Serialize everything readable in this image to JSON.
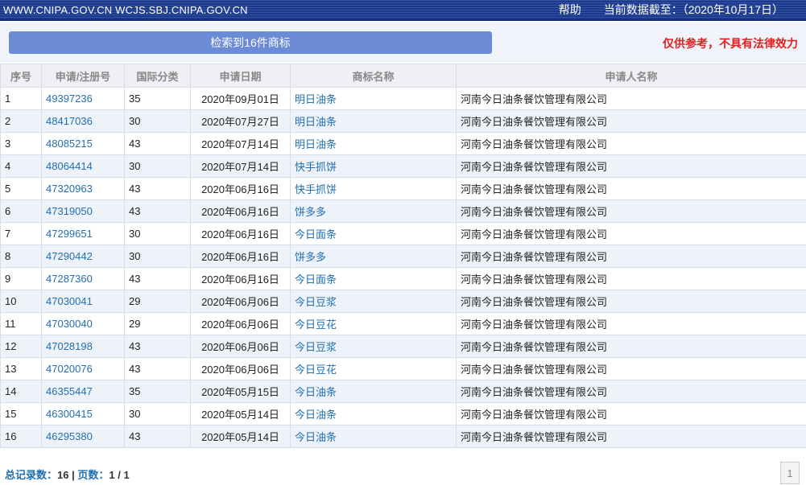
{
  "topbar": {
    "site": "WWW.CNIPA.GOV.CN WCJS.SBJ.CNIPA.GOV.CN",
    "help": "帮助",
    "data_date": "当前数据截至：（2020年10月17日）"
  },
  "search": {
    "count_label": "检索到16件商标",
    "notice": "仅供参考，不具有法律效力"
  },
  "table": {
    "headers": [
      "序号",
      "申请/注册号",
      "国际分类",
      "申请日期",
      "商标名称",
      "申请人名称"
    ],
    "rows": [
      [
        "1",
        "49397236",
        "35",
        "2020年09月01日",
        "明日油条",
        "河南今日油条餐饮管理有限公司"
      ],
      [
        "2",
        "48417036",
        "30",
        "2020年07月27日",
        "明日油条",
        "河南今日油条餐饮管理有限公司"
      ],
      [
        "3",
        "48085215",
        "43",
        "2020年07月14日",
        "明日油条",
        "河南今日油条餐饮管理有限公司"
      ],
      [
        "4",
        "48064414",
        "30",
        "2020年07月14日",
        "快手抓饼",
        "河南今日油条餐饮管理有限公司"
      ],
      [
        "5",
        "47320963",
        "43",
        "2020年06月16日",
        "快手抓饼",
        "河南今日油条餐饮管理有限公司"
      ],
      [
        "6",
        "47319050",
        "43",
        "2020年06月16日",
        "饼多多",
        "河南今日油条餐饮管理有限公司"
      ],
      [
        "7",
        "47299651",
        "30",
        "2020年06月16日",
        "今日面条",
        "河南今日油条餐饮管理有限公司"
      ],
      [
        "8",
        "47290442",
        "30",
        "2020年06月16日",
        "饼多多",
        "河南今日油条餐饮管理有限公司"
      ],
      [
        "9",
        "47287360",
        "43",
        "2020年06月16日",
        "今日面条",
        "河南今日油条餐饮管理有限公司"
      ],
      [
        "10",
        "47030041",
        "29",
        "2020年06月06日",
        "今日豆浆",
        "河南今日油条餐饮管理有限公司"
      ],
      [
        "11",
        "47030040",
        "29",
        "2020年06月06日",
        "今日豆花",
        "河南今日油条餐饮管理有限公司"
      ],
      [
        "12",
        "47028198",
        "43",
        "2020年06月06日",
        "今日豆浆",
        "河南今日油条餐饮管理有限公司"
      ],
      [
        "13",
        "47020076",
        "43",
        "2020年06月06日",
        "今日豆花",
        "河南今日油条餐饮管理有限公司"
      ],
      [
        "14",
        "46355447",
        "35",
        "2020年05月15日",
        "今日油条",
        "河南今日油条餐饮管理有限公司"
      ],
      [
        "15",
        "46300415",
        "30",
        "2020年05月14日",
        "今日油条",
        "河南今日油条餐饮管理有限公司"
      ],
      [
        "16",
        "46295380",
        "43",
        "2020年05月14日",
        "今日油条",
        "河南今日油条餐饮管理有限公司"
      ]
    ]
  },
  "footer": {
    "total_label": "总记录数：",
    "total_value": "16",
    "separator": " | ",
    "pages_label": "页数：",
    "pages_value": "1 / 1",
    "current_page": "1"
  }
}
